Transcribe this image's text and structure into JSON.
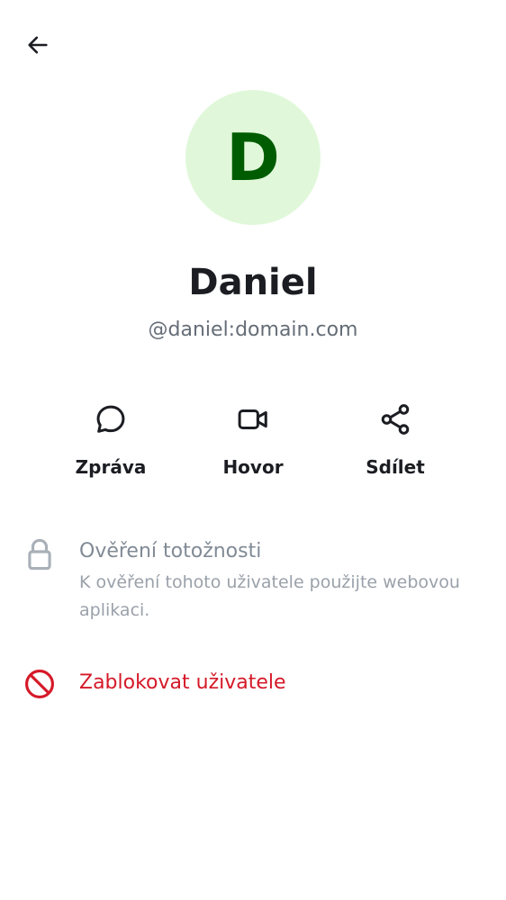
{
  "header": {
    "back_icon": "arrow-left-icon"
  },
  "profile": {
    "avatar_initial": "D",
    "avatar_bg": "#e0f8d9",
    "avatar_fg": "#005c00",
    "name": "Daniel",
    "user_id": "@daniel:domain.com"
  },
  "actions": [
    {
      "label": "Zpráva",
      "icon": "chat-bubble-icon"
    },
    {
      "label": "Hovor",
      "icon": "video-camera-icon"
    },
    {
      "label": "Sdílet",
      "icon": "share-icon"
    }
  ],
  "verification": {
    "icon": "lock-icon",
    "title": "Ověření totožnosti",
    "description": "K ověření tohoto uživatele použijte webovou aplikaci."
  },
  "block_user": {
    "icon": "block-icon",
    "label": "Zablokovat uživatele",
    "color": "#d51928"
  },
  "colors": {
    "text_primary": "#1b1d22",
    "text_secondary": "#656d77",
    "text_disabled": "#818a95",
    "critical": "#d51928"
  }
}
